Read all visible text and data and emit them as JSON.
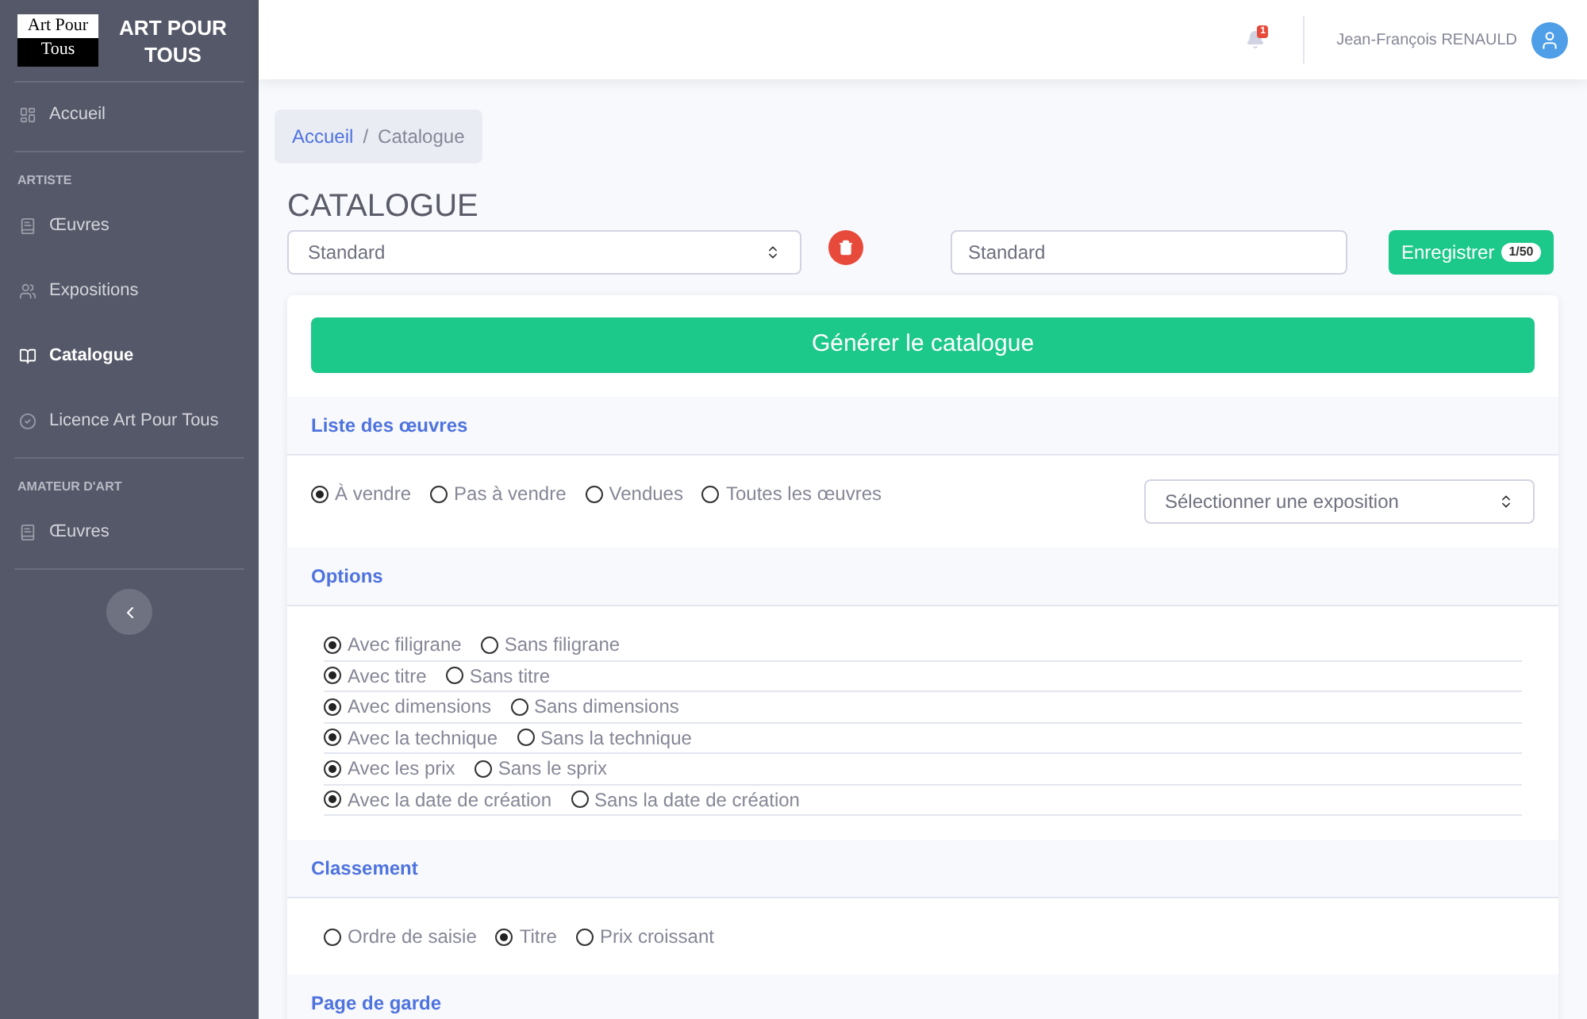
{
  "sidebar": {
    "logo": {
      "line_1": "Art Pour",
      "line_2": "Tous"
    },
    "brand": "ART POUR TOUS",
    "groups": [
      {
        "items": [
          {
            "label": "Accueil",
            "kind": "dashboard",
            "selected": false
          }
        ]
      },
      {
        "heading": "ARTISTE",
        "items": [
          {
            "label": "Œuvres",
            "kind": "book",
            "selected": false
          },
          {
            "label": "Expositions",
            "kind": "users",
            "selected": false
          },
          {
            "label": "Catalogue",
            "kind": "open-book",
            "selected": true
          },
          {
            "label": "Licence Art Pour Tous",
            "kind": "check",
            "selected": false
          }
        ]
      },
      {
        "heading": "AMATEUR D'ART",
        "items": [
          {
            "label": "Œuvres",
            "kind": "book",
            "selected": false
          }
        ]
      }
    ]
  },
  "topbar": {
    "notification_count": "1",
    "user_name": "Jean-François RENAULD"
  },
  "breadcrumb": {
    "separator": "/",
    "items": [
      {
        "label": "Accueil",
        "link": true
      },
      {
        "label": "Catalogue",
        "link": false
      }
    ]
  },
  "page_title": "CATALOGUE",
  "template_select": {
    "value": "Standard"
  },
  "name_field": {
    "value": "Standard"
  },
  "save_button": {
    "label": "Enregistrer",
    "badge": "1/50"
  },
  "generate_button": "Générer le catalogue",
  "sections": [
    {
      "title": "Liste des œuvres",
      "kind": "list",
      "options": [
        {
          "label": "À vendre",
          "selected": true
        },
        {
          "label": "Pas à vendre",
          "selected": false
        },
        {
          "label": "Vendues",
          "selected": false
        },
        {
          "label": "Toutes les œuvres",
          "selected": false
        }
      ],
      "select": {
        "value": "Sélectionner une exposition"
      }
    },
    {
      "title": "Options",
      "kind": "rows",
      "rows": [
        [
          {
            "label": "Avec filigrane",
            "selected": true
          },
          {
            "label": "Sans filigrane",
            "selected": false
          }
        ],
        [
          {
            "label": "Avec titre",
            "selected": true
          },
          {
            "label": "Sans titre",
            "selected": false
          }
        ],
        [
          {
            "label": "Avec dimensions",
            "selected": true
          },
          {
            "label": "Sans dimensions",
            "selected": false
          }
        ],
        [
          {
            "label": "Avec la technique",
            "selected": true
          },
          {
            "label": "Sans la technique",
            "selected": false
          }
        ],
        [
          {
            "label": "Avec les prix",
            "selected": true
          },
          {
            "label": "Sans le sprix",
            "selected": false
          }
        ],
        [
          {
            "label": "Avec la date de création",
            "selected": true
          },
          {
            "label": "Sans la date de création",
            "selected": false
          }
        ]
      ]
    },
    {
      "title": "Classement",
      "kind": "inline",
      "options": [
        {
          "label": "Ordre de saisie",
          "selected": false
        },
        {
          "label": "Titre",
          "selected": true
        },
        {
          "label": "Prix croissant",
          "selected": false
        }
      ]
    },
    {
      "title": "Page de garde",
      "kind": "header"
    }
  ]
}
